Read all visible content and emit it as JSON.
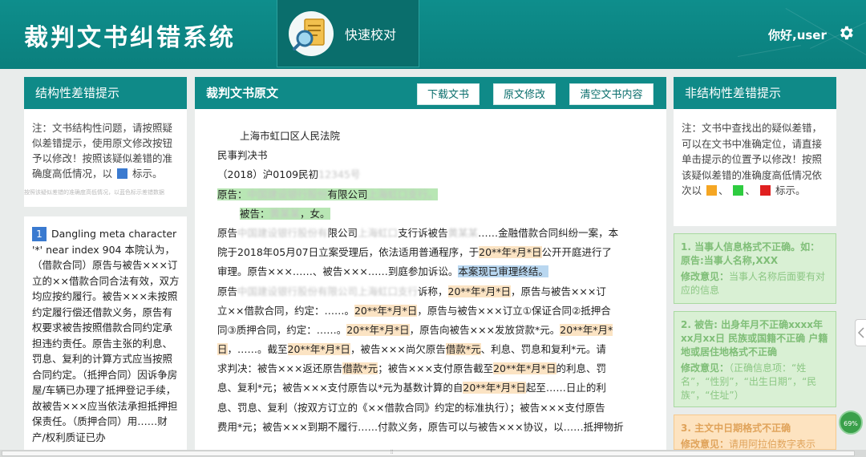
{
  "app": {
    "title": "裁判文书纠错系统",
    "quick_tab_label": "快速校对",
    "greeting": "你好,user"
  },
  "colors": {
    "header_bg": "#0e8e8c",
    "panel_head_bg": "#0f8a88",
    "legend_blue": "#3a7ad0",
    "legend_orange": "#f5a623",
    "legend_green": "#2ecc40",
    "legend_red": "#e02020"
  },
  "left": {
    "title": "结构性差错提示",
    "note_text": "注：文书结构性问题，请按照疑似差错提示，使用原文修改按钮予以修改！按照该疑似差错的准确度高低情况，以",
    "note_tail": "标示。",
    "ghost_tip": "按照该疑似差错的准确度高低情况，以蓝色标示差错数据",
    "error_number": "1",
    "error_text": "Dangling meta character '*' near index 904 本院认为，（借款合同）原告与被告×××订立的××借款合同合法有效，双方均应按约履行。被告×××未按照约定履行偿还借款义务，原告有权要求被告按照借款合同约定承担违约责任。原告主张的利息、罚息、复利的计算方式应当按照合同约定。（抵押合同）因诉争房屋/车辆已办理了抵押登记手续，故被告×××应当依法承担抵押担保责任。（质押合同）用……财产/权利质证已办"
  },
  "middle": {
    "title": "裁判文书原文",
    "buttons": {
      "download": "下载文书",
      "edit": "原文修改",
      "clear": "清空文书内容"
    },
    "doc": {
      "court": "上海市虹口区人民法院",
      "doc_type": "民事判决书",
      "case_no": "（2018）沪0109民初",
      "plaintiff_line": "原告：",
      "plaintiff_company_suffix": "有限公司",
      "defendant_line": "被告：",
      "defendant_suffix": "，女。",
      "l6a": "原告",
      "l6b": "限公司",
      "l6c": "支行诉被告",
      "l6d": "……金融借款合同纠纷一案，本",
      "l7a": "院于2018年05月07日立案受理后，依法适用普通程序，于",
      "l7b": "20**年*月*日",
      "l7c": "公开开庭进行了",
      "l8a": "审理。原告×××……、被告×××……到庭参加诉讼。",
      "l8b": "本案现已审理终结。",
      "l9a": "原告",
      "l9b": "诉称，",
      "l9c": "20**年*月*日",
      "l9d": "，原告与被告×××订",
      "l10a": "立××借款合同，约定：……。",
      "l10b": "20**年*月*日",
      "l10c": "，原告与被告×××订立①保证合同②抵押合",
      "l11a": "同③质押合同，约定：……。",
      "l11b": "20**年*月*日",
      "l11c": "，原告向被告×××发放贷款*元。",
      "l11d": "20**年*月*",
      "l12a": "日",
      "l12b": "，……。截至",
      "l12c": "20**年*月*日",
      "l12d": "，被告×××尚欠原告",
      "l12e": "借款*元",
      "l12f": "、利息、罚息和复利*元。请",
      "l13a": "求判决：被告×××返还原告",
      "l13b": "借款*元",
      "l13c": "；被告×××支付原告截至",
      "l13d": "20**年*月*日",
      "l13e": "的利息、罚",
      "l14a": "息、复利*元；被告×××支付原告以*元为基数计算的自",
      "l14b": "20**年*月*日",
      "l14c": "起至……日止的利",
      "l15": "息、罚息、复利（按双方订立的《××借款合同》约定的标准执行）；被告×××支付原告",
      "l16": "费用*元；被告×××到期不履行……付款义务，原告可以与被告×××协议，以……抵押物折"
    }
  },
  "right": {
    "title": "非结构性差错提示",
    "note_text": "注：文书中查找出的疑似差错，可以在文书中准确定位，请直接单击提示的位置予以修改！按照该疑似差错的准确度高低情况依次以",
    "note_tail": "标示。",
    "cards": [
      {
        "title": "1. 当事人信息格式不正确。如：原告:当事人名称,XXX",
        "label": "修改意见：",
        "body": "当事人名称后面要有对应的信息"
      },
      {
        "title": "2. 被告: 出身年月不正确xxxx年xx月xx日 民族或国籍不正确 户籍地或居住地格式不正确",
        "label": "修改意见：",
        "body": "（正确信息项：“姓名”，“性别”，“出生日期”，“民族”，“住址”）"
      },
      {
        "title": "3. 主文中日期格式不正确",
        "label": "修改意见：",
        "body": "请用阿拉伯数字表示"
      }
    ]
  },
  "misc": {
    "progress_badge": "69%"
  }
}
